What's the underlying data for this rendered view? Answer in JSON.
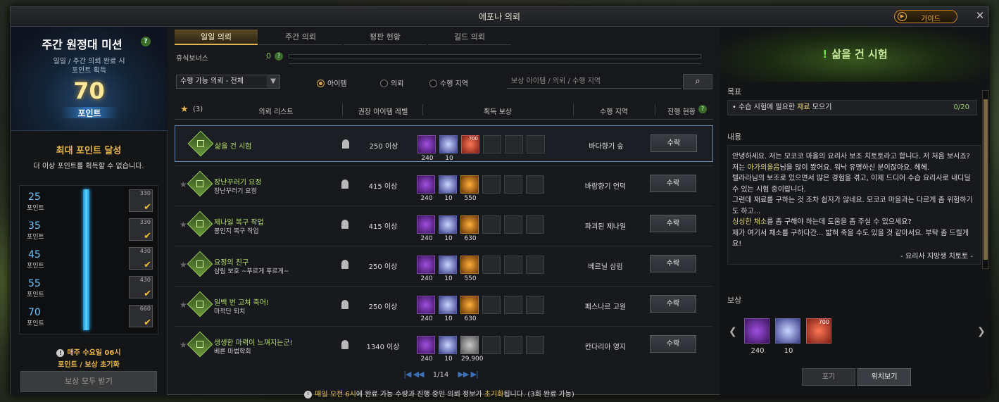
{
  "window": {
    "title": "에포나 의뢰",
    "guide_label": "가이드",
    "close_icon": "✕"
  },
  "mission": {
    "title": "주간 원정대 미션",
    "desc_line1": "일일 / 주간 의뢰 완료 시",
    "desc_line2": "포인트 획득",
    "points": "70",
    "points_unit": "포인트",
    "max_title": "최대 포인트 달성",
    "max_desc": "더 이상 포인트를 획득할 수 없습니다.",
    "milestones": [
      {
        "points": "25",
        "label": "포인트",
        "reward_count": "330",
        "claimed": true
      },
      {
        "points": "35",
        "label": "포인트",
        "reward_count": "330",
        "claimed": true
      },
      {
        "points": "45",
        "label": "포인트",
        "reward_count": "430",
        "claimed": true
      },
      {
        "points": "55",
        "label": "포인트",
        "reward_count": "430",
        "claimed": true
      },
      {
        "points": "70",
        "label": "포인트",
        "reward_count": "660",
        "claimed": true
      }
    ],
    "reset_line1": "매주 수요일 06시",
    "reset_line2": "포인트 / 보상 초기화",
    "claim_all_label": "보상 모두 받기"
  },
  "tabs": [
    {
      "label": "일일 의뢰",
      "active": true
    },
    {
      "label": "주간 의뢰",
      "active": false
    },
    {
      "label": "평판 현황",
      "active": false
    },
    {
      "label": "길드 의뢰",
      "active": false
    }
  ],
  "rest_bonus": {
    "label": "휴식보너스",
    "value": "0"
  },
  "filter": {
    "dropdown_value": "수행 가능 의뢰 - 전체",
    "radios": [
      {
        "label": "아이템",
        "selected": true
      },
      {
        "label": "의뢰",
        "selected": false
      },
      {
        "label": "수행 지역",
        "selected": false
      }
    ],
    "search_placeholder": "보상 아이템 / 의뢰 / 수행 지역"
  },
  "table": {
    "fav_count": "(3)",
    "headers": [
      "의뢰 리스트",
      "권장 아이템 레벨",
      "획득 보상",
      "수행 지역",
      "진행 현황"
    ],
    "rows": [
      {
        "name": "삶을 건 시험",
        "sub": "",
        "level": "250 이상",
        "area": "바다향기 숲",
        "action": "수락",
        "rewards": [
          {
            "type": "gem",
            "count": "240"
          },
          {
            "type": "crys",
            "count": "10"
          },
          {
            "type": "heart",
            "count": "",
            "badge": "700"
          }
        ]
      },
      {
        "name": "장난꾸러기 요정",
        "sub": "장난꾸러기 요정",
        "level": "415 이상",
        "area": "바람향기 언덕",
        "action": "수락",
        "rewards": [
          {
            "type": "gem",
            "count": "240"
          },
          {
            "type": "crys",
            "count": "10"
          },
          {
            "type": "fire",
            "count": "550"
          }
        ]
      },
      {
        "name": "제나일 복구 작업",
        "sub": "봉인지 복구 작업",
        "level": "415 이상",
        "area": "파괴된 제나일",
        "action": "수락",
        "rewards": [
          {
            "type": "gem",
            "count": "240"
          },
          {
            "type": "crys",
            "count": "10"
          },
          {
            "type": "fire",
            "count": "630"
          }
        ]
      },
      {
        "name": "요정의 친구",
        "sub": "삼림 보호 ~푸르게 푸르게~",
        "level": "250 이상",
        "area": "베르닐 삼림",
        "action": "수락",
        "rewards": [
          {
            "type": "gem",
            "count": "240"
          },
          {
            "type": "crys",
            "count": "10"
          },
          {
            "type": "fire",
            "count": "550"
          }
        ]
      },
      {
        "name": "일백 번 고쳐 죽어!",
        "sub": "마적단 퇴치",
        "level": "250 이상",
        "area": "페스나르 고원",
        "action": "수락",
        "rewards": [
          {
            "type": "gem",
            "count": "240"
          },
          {
            "type": "crys",
            "count": "10"
          },
          {
            "type": "fire",
            "count": "630"
          }
        ]
      },
      {
        "name": "생생한 마력이 느껴지는군!",
        "sub": "베른 마법학회",
        "level": "1340 이상",
        "area": "칸다리아 영지",
        "action": "수락",
        "rewards": [
          {
            "type": "gem",
            "count": "240"
          },
          {
            "type": "crys",
            "count": "10"
          },
          {
            "type": "coin",
            "count": "29,900"
          }
        ]
      }
    ]
  },
  "pager": {
    "text": "1/14"
  },
  "notice": {
    "p1": "매일 오전 6시",
    "p2": "에 완료 가능 수량과 진행 중인 의뢰 정보가 ",
    "p3": "초기화",
    "p4": "됩니다. (3회 완료 가능)"
  },
  "detail": {
    "title": "삶을 건 시험",
    "goal_label": "목표",
    "goal_pre": "• 수습 시험에 필요한 ",
    "goal_hl": "재료",
    "goal_post": " 모으기",
    "goal_progress": "0/20",
    "content_label": "내용",
    "content": [
      {
        "t": "안녕하세요. 저는 모코코 마을의 요리사 보조 치토토라고 합니다. 저 처음 보시죠? 저는 ",
        "h": "아가의올음",
        "t2": "님을 많이 봤어요. 워낙 유명하신 분이잖아요. 헤헤."
      },
      {
        "t": "텔라라님의 보조로 있으면서 많은 경험을 겪고, 이제 드디어 수습 요리사로 내디딜 수 있는 시험 중이랍니다.",
        "h": "",
        "t2": ""
      },
      {
        "t": "그런데 재료를 구하는 것 조차 쉽지가 않네요. 모코코 마을과는 다르게 좀 위험하기도 하고...",
        "h": "",
        "t2": ""
      },
      {
        "t": "",
        "h": "싱싱한 채소",
        "t2": "를 좀 구해야 하는데 도움을 좀 주실 수 있으세요?"
      },
      {
        "t": "제가 여기서 채소를 구하다간... 밟혀 죽을 수도 있을 것 같아서요. 부탁 좀 드릴게요!",
        "h": "",
        "t2": ""
      }
    ],
    "signature": "- 요리사 지망생 치토토 -",
    "reward_label": "보상",
    "rewards": [
      {
        "type": "gem",
        "count": "240"
      },
      {
        "type": "crys",
        "count": "10"
      },
      {
        "type": "heart",
        "count": "",
        "badge": "700"
      }
    ],
    "giveup_label": "포기",
    "locate_label": "위치보기"
  }
}
